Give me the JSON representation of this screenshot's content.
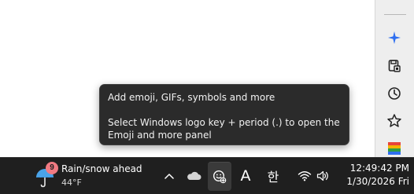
{
  "tooltip": {
    "title": "Add emoji, GIFs, symbols and more",
    "body": "Select Windows logo key + period (.) to open the Emoji and more panel"
  },
  "side_panel": {
    "icons": [
      "copilot-icon",
      "save-icon",
      "history-icon",
      "favorites-icon",
      "office-icon"
    ]
  },
  "taskbar": {
    "weather": {
      "badge": "9",
      "title": "Rain/snow ahead",
      "temp": "44°F"
    },
    "tray": {
      "ime_mode": "A",
      "ime_lang": "한"
    },
    "clock": {
      "time": "12:49:42 PM",
      "date": "1/30/2026 Fri"
    }
  },
  "colors": {
    "taskbar_bg": "#1f1f1f",
    "tooltip_bg": "#2b2b2b",
    "badge": "#f07a82",
    "accent": "#2f6ff0"
  }
}
